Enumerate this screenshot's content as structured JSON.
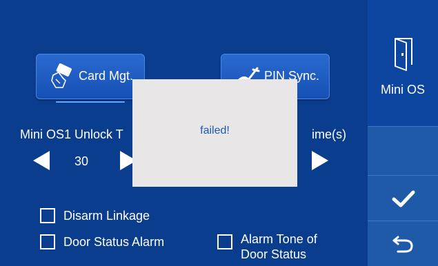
{
  "buttons": {
    "card_mgt": "Card Mgt.",
    "pin_sync": "PIN Sync."
  },
  "unlock": {
    "left_label": "Mini OS1 Unlock T",
    "right_label": "ime(s)",
    "value": "30"
  },
  "options": {
    "disarm_linkage": "Disarm Linkage",
    "door_status_alarm": "Door Status Alarm",
    "alarm_tone_line1": "Alarm Tone of",
    "alarm_tone_line2": "Door Status"
  },
  "dialog": {
    "message": "failed!"
  },
  "sidebar": {
    "mini_os": "Mini OS"
  },
  "colors": {
    "background": "#0b3d8f",
    "sidebar": "#1f5aa9",
    "dialog_bg": "#e8e6e6",
    "dialog_text": "#1f5aa9"
  }
}
